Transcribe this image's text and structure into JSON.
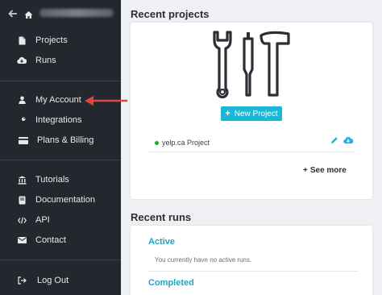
{
  "sidebar": {
    "items": [
      {
        "label": "Projects",
        "icon": "file-icon"
      },
      {
        "label": "Runs",
        "icon": "cloud-download-icon"
      },
      {
        "label": "My Account",
        "icon": "user-icon"
      },
      {
        "label": "Integrations",
        "icon": "wrench-icon"
      },
      {
        "label": "Plans & Billing",
        "icon": "credit-card-icon"
      },
      {
        "label": "Tutorials",
        "icon": "bank-icon"
      },
      {
        "label": "Documentation",
        "icon": "book-icon"
      },
      {
        "label": "API",
        "icon": "code-icon"
      },
      {
        "label": "Contact",
        "icon": "envelope-icon"
      },
      {
        "label": "Log Out",
        "icon": "sign-out-icon"
      }
    ]
  },
  "colors": {
    "sidebar_bg": "#23272e",
    "accent": "#19b7d8",
    "arrow": "#e0463d",
    "online": "#2aa62a"
  },
  "recent_projects": {
    "title": "Recent projects",
    "new_button": "New Project",
    "projects": [
      {
        "name": "yelp.ca Project",
        "status": "active"
      }
    ],
    "see_more": "See more"
  },
  "recent_runs": {
    "title": "Recent runs",
    "active_label": "Active",
    "active_empty": "You currently have no active runs.",
    "completed_label": "Completed"
  }
}
